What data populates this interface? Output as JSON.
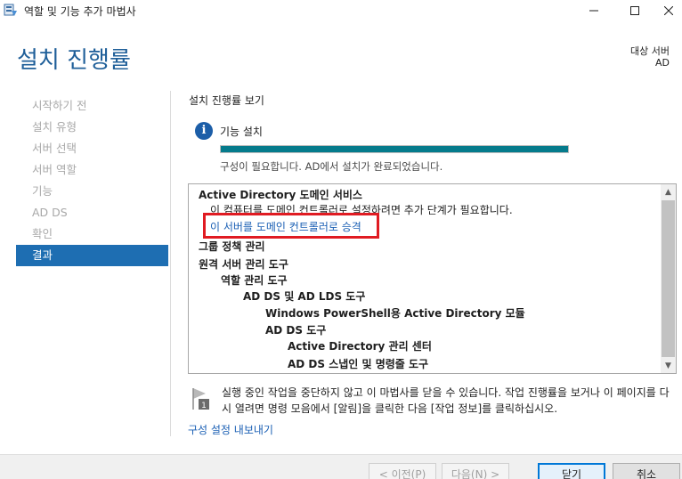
{
  "window": {
    "title": "역할 및 기능 추가 마법사"
  },
  "header": {
    "title": "설치 진행률",
    "target_label": "대상 서버",
    "target_value": "AD"
  },
  "nav": {
    "items": [
      {
        "label": "시작하기 전",
        "active": false
      },
      {
        "label": "설치 유형",
        "active": false
      },
      {
        "label": "서버 선택",
        "active": false
      },
      {
        "label": "서버 역할",
        "active": false
      },
      {
        "label": "기능",
        "active": false
      },
      {
        "label": "AD DS",
        "active": false
      },
      {
        "label": "확인",
        "active": false
      },
      {
        "label": "결과",
        "active": true
      }
    ]
  },
  "main": {
    "section_title": "설치 진행률 보기",
    "feature_label": "기능 설치",
    "progress": 1.0,
    "status_text": "구성이 필요합니다. AD에서 설치가 완료되었습니다.",
    "results": [
      {
        "text": "Active Directory 도메인 서비스",
        "indent": 0,
        "bold": true
      },
      {
        "text": "이 컴퓨터를 도메인 컨트롤러로 설정하려면 추가 단계가 필요합니다.",
        "indent": 1,
        "bold": false
      },
      {
        "text": "이 서버를 도메인 컨트롤러로 승격",
        "indent": 1,
        "link": true
      },
      {
        "text": "그룹 정책 관리",
        "indent": 0,
        "bold": true
      },
      {
        "text": "원격 서버 관리 도구",
        "indent": 0,
        "bold": true
      },
      {
        "text": "역할 관리 도구",
        "indent": 1,
        "bold": true
      },
      {
        "text": "AD DS 및 AD LDS 도구",
        "indent": 2,
        "bold": true
      },
      {
        "text": "Windows PowerShell용 Active Directory 모듈",
        "indent": 3,
        "bold": true
      },
      {
        "text": "AD DS 도구",
        "indent": 3,
        "bold": true
      },
      {
        "text": "Active Directory 관리 센터",
        "indent": 4,
        "bold": true
      },
      {
        "text": "AD DS 스냅인 및 명령줄 도구",
        "indent": 4,
        "bold": true
      }
    ],
    "note_text": "실행 중인 작업을 중단하지 않고 이 마법사를 닫을 수 있습니다. 작업 진행률을 보거나 이 페이지를 다시 열려면 명령 모음에서 [알림]을 클릭한 다음 [작업 정보]를 클릭하십시오.",
    "export_link": "구성 설정 내보내기"
  },
  "footer": {
    "prev_label": "< 이전(P)",
    "next_label": "다음(N) >",
    "close_label": "닫기",
    "cancel_label": "취소"
  },
  "colors": {
    "title_blue": "#1f5f99",
    "nav_active": "#1e6eb2",
    "progress_fill": "#057b8c",
    "link": "#1a5fb4",
    "highlight_red": "#e01b22"
  }
}
